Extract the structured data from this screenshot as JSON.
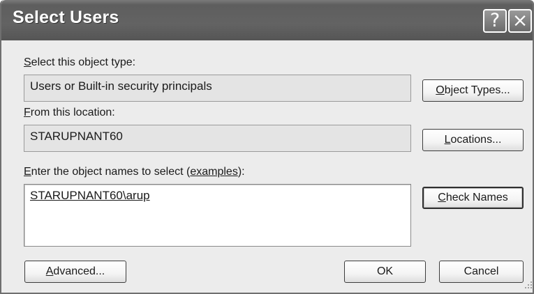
{
  "window": {
    "title": "Select Users",
    "help_glyph": "?",
    "close_glyph": "×"
  },
  "object_type": {
    "label_key": "S",
    "label_rest": "elect this object type:",
    "value": "Users or Built-in security principals",
    "button_key": "O",
    "button_rest": "bject Types..."
  },
  "location": {
    "label_key": "F",
    "label_rest": "rom this location:",
    "value": "STARUPNANT60",
    "button_key": "L",
    "button_rest": "ocations..."
  },
  "names": {
    "label_key": "E",
    "label_rest": "nter the object names to select (",
    "label_link": "examples",
    "label_end": "):",
    "value": "STARUPNANT60\\arup",
    "button_key": "C",
    "button_rest": "heck Names"
  },
  "footer": {
    "advanced_key": "A",
    "advanced_rest": "dvanced...",
    "ok": "OK",
    "cancel": "Cancel"
  }
}
